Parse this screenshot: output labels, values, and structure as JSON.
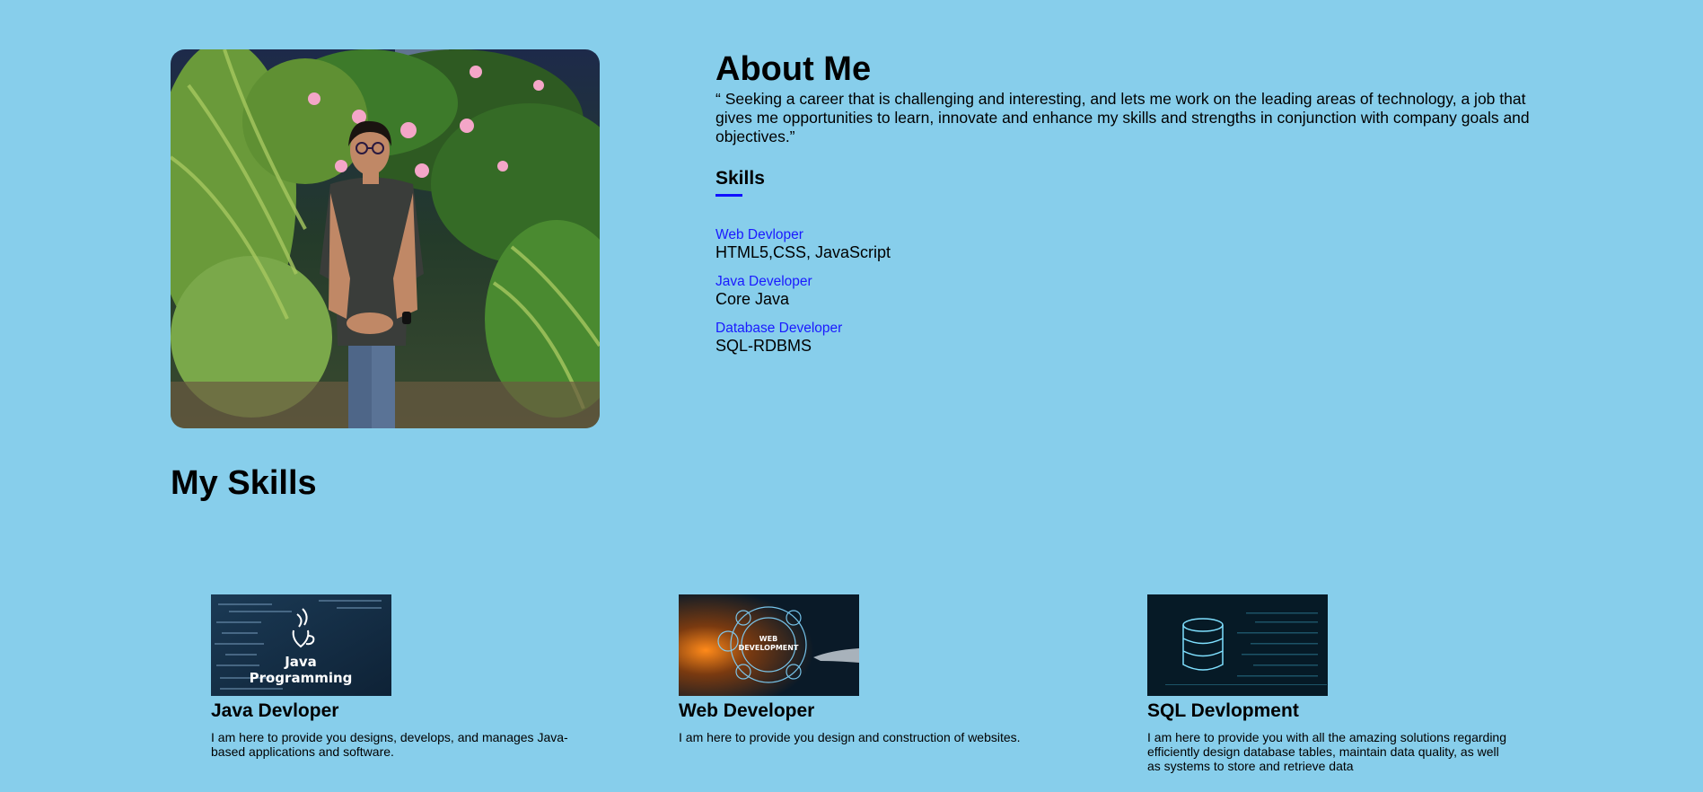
{
  "about": {
    "title": "About Me",
    "text": "“ Seeking a career that is challenging and interesting, and lets me work on the leading areas of technology, a job that gives me opportunities to learn, innovate and enhance my skills and strengths in conjunction with company goals and objectives.”",
    "skills_title": "Skills",
    "skills": [
      {
        "role": "Web Devloper",
        "tech": "HTML5,CSS, JavaScript"
      },
      {
        "role": "Java Developer",
        "tech": "Core Java"
      },
      {
        "role": "Database Developer",
        "tech": "SQL-RDBMS"
      }
    ]
  },
  "my_skills": {
    "title": "My Skills",
    "cards": [
      {
        "image_caption_line1": "Java",
        "image_caption_line2": "Programming",
        "title": "Java Devloper",
        "text": "I am here to provide you designs, develops, and manages Java-based applications and software."
      },
      {
        "image_caption_line1": "WEB",
        "image_caption_line2": "DEVELOPMENT",
        "title": "Web Developer",
        "text": "I am here to provide you design and construction of websites."
      },
      {
        "title": "SQL Devlopment",
        "text": "I am here to provide you with all the amazing solutions regarding efficiently design database tables, maintain data quality, as well as systems to store and retrieve data"
      }
    ]
  },
  "colors": {
    "background": "#87ceeb",
    "accent": "#1010ff",
    "skill_role": "#1a1aff"
  },
  "icons": {
    "java": "java-logo-icon",
    "web": "globe-network-icon",
    "sql": "database-icon"
  }
}
